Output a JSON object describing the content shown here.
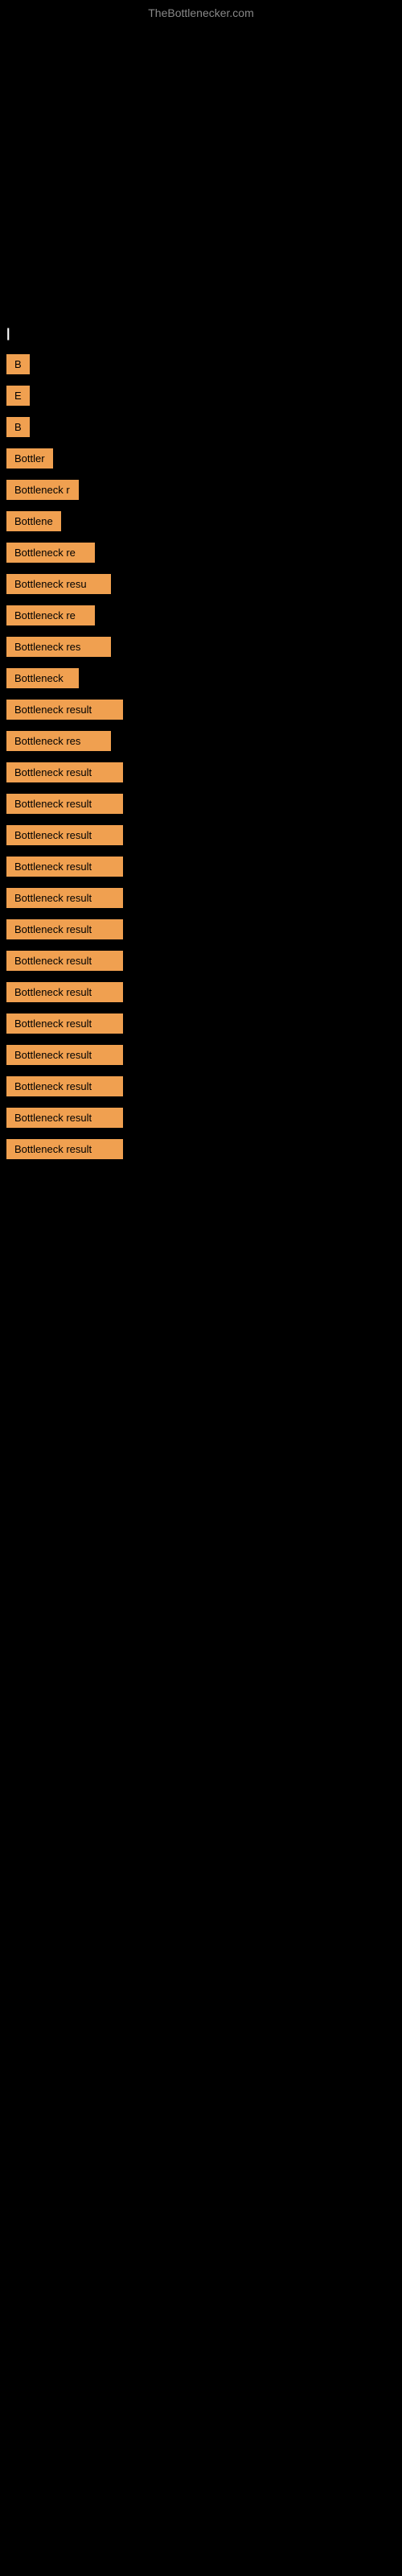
{
  "site": {
    "title": "TheBottlenecker.com"
  },
  "sectionLabel": "|",
  "items": [
    {
      "id": 1,
      "label": "B",
      "widthClass": "w-tiny"
    },
    {
      "id": 2,
      "label": "E",
      "widthClass": "w-tiny"
    },
    {
      "id": 3,
      "label": "B",
      "widthClass": "w-tiny"
    },
    {
      "id": 4,
      "label": "Bottler",
      "widthClass": "w-med-sm"
    },
    {
      "id": 5,
      "label": "Bottleneck r",
      "widthClass": "w-med"
    },
    {
      "id": 6,
      "label": "Bottlene",
      "widthClass": "w-med-sm"
    },
    {
      "id": 7,
      "label": "Bottleneck re",
      "widthClass": "w-med-lg"
    },
    {
      "id": 8,
      "label": "Bottleneck resu",
      "widthClass": "w-large"
    },
    {
      "id": 9,
      "label": "Bottleneck re",
      "widthClass": "w-med-lg"
    },
    {
      "id": 10,
      "label": "Bottleneck res",
      "widthClass": "w-large"
    },
    {
      "id": 11,
      "label": "Bottleneck",
      "widthClass": "w-med"
    },
    {
      "id": 12,
      "label": "Bottleneck result",
      "widthClass": "w-full"
    },
    {
      "id": 13,
      "label": "Bottleneck res",
      "widthClass": "w-large"
    },
    {
      "id": 14,
      "label": "Bottleneck result",
      "widthClass": "w-full"
    },
    {
      "id": 15,
      "label": "Bottleneck result",
      "widthClass": "w-full"
    },
    {
      "id": 16,
      "label": "Bottleneck result",
      "widthClass": "w-full"
    },
    {
      "id": 17,
      "label": "Bottleneck result",
      "widthClass": "w-full"
    },
    {
      "id": 18,
      "label": "Bottleneck result",
      "widthClass": "w-full"
    },
    {
      "id": 19,
      "label": "Bottleneck result",
      "widthClass": "w-full"
    },
    {
      "id": 20,
      "label": "Bottleneck result",
      "widthClass": "w-full"
    },
    {
      "id": 21,
      "label": "Bottleneck result",
      "widthClass": "w-full"
    },
    {
      "id": 22,
      "label": "Bottleneck result",
      "widthClass": "w-full"
    },
    {
      "id": 23,
      "label": "Bottleneck result",
      "widthClass": "w-full"
    },
    {
      "id": 24,
      "label": "Bottleneck result",
      "widthClass": "w-full"
    },
    {
      "id": 25,
      "label": "Bottleneck result",
      "widthClass": "w-full"
    },
    {
      "id": 26,
      "label": "Bottleneck result",
      "widthClass": "w-full"
    }
  ]
}
